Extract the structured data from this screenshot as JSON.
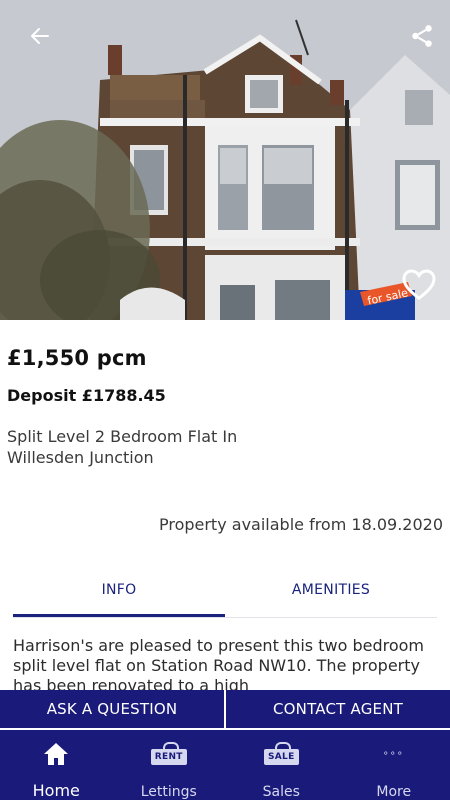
{
  "listing": {
    "price": "£1,550 pcm",
    "deposit": "Deposit £1788.45",
    "title": "Split Level 2 Bedroom Flat In Willesden Junction",
    "availability": "Property available from 18.09.2020",
    "sign_text": "for sale",
    "description": "Harrison's are pleased to present this two bedroom split level flat on Station Road NW10. The property has been renovated to a high"
  },
  "hero": {
    "icons": {
      "back": "arrow-left-icon",
      "share": "share-icon",
      "favourite": "heart-outline-icon"
    }
  },
  "tabs": [
    {
      "label": "INFO",
      "active": true
    },
    {
      "label": "AMENITIES",
      "active": false
    }
  ],
  "actions": {
    "ask": "ASK A QUESTION",
    "contact": "CONTACT AGENT"
  },
  "nav": {
    "home": "Home",
    "lettings": "Lettings",
    "lettings_badge": "RENT",
    "sales": "Sales",
    "sales_badge": "SALE",
    "more": "More",
    "more_icon": "°°°"
  },
  "colors": {
    "brand": "#1a1a7a",
    "tab_text": "#1a237e"
  }
}
